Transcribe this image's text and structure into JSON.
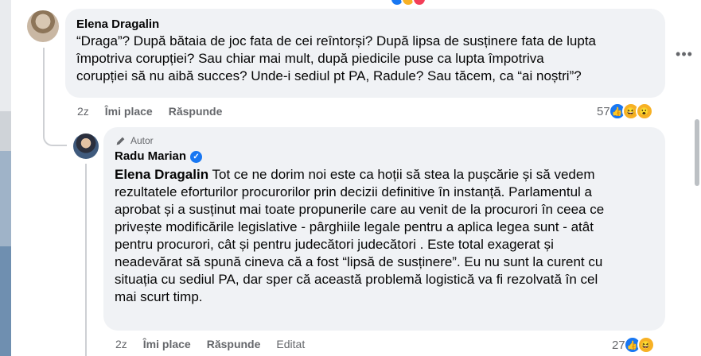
{
  "comments": [
    {
      "author": "Elena Dragalin",
      "text": "“Draga”? După bătaia de joc fata de cei reîntorși? După lipsa de susținere fata de lupta\nîmpotriva corupției? Sau chiar mai mult, după piedicile puse ca lupta împotriva\ncorupției să nu aibă succes? Unde-i sediul pt PA, Radule? Sau tăcem, ca “ai noștri”?",
      "time": "2z",
      "like_label": "Îmi place",
      "reply_label": "Răspunde",
      "reaction_count": "57",
      "reactions": [
        "like",
        "haha",
        "wow"
      ]
    },
    {
      "badge": "Autor",
      "author": "Radu Marian",
      "mention": "Elena Dragalin",
      "text": " Tot ce ne dorim noi este ca hoții să stea la pușcărie și să vedem\nrezultatele eforturilor procurorilor prin decizii definitive în instanță. Parlamentul a\naprobat și a susținut mai toate propunerile care au venit de la procurori în ceea ce\nprivește modificările legislative - pârghiile legale pentru a aplica legea sunt - atât\npentru procurori, cât și pentru judecători judecători . Este total exagerat și\nneadevărat să spună cineva că a fost “lipsă de susținere”. Eu nu sunt la curent cu\nsituația cu sediul PA, dar sper că această problemă logistică va fi rezolvată în cel\nmai scurt timp.",
      "time": "2z",
      "like_label": "Îmi place",
      "reply_label": "Răspunde",
      "edited_label": "Editat",
      "reaction_count": "27",
      "reactions": [
        "like",
        "haha"
      ]
    }
  ],
  "more_icon": "more-horizontal-icon",
  "colors": {
    "bubble": "#f0f2f5",
    "meta_text": "#65676b",
    "accent_blue": "#1877f2",
    "reaction_yellow": "#f7b125"
  }
}
